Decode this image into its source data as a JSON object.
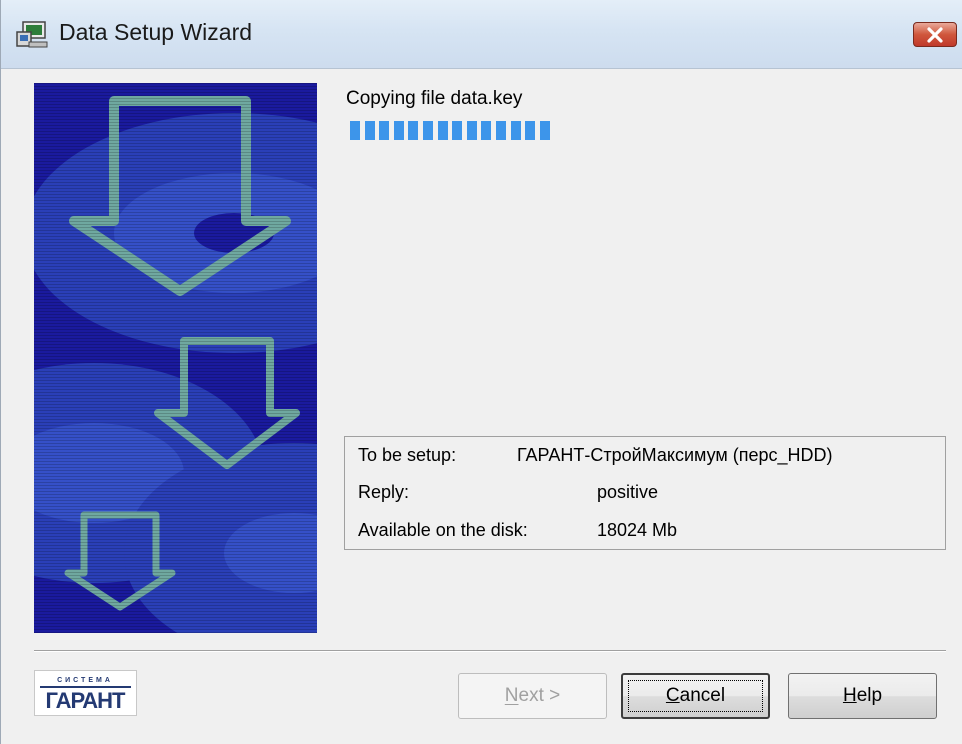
{
  "window": {
    "title": "Data Setup Wizard",
    "title_icon": "setup-wizard-icon",
    "close_icon": "close-icon"
  },
  "main": {
    "status_label": "Copying file data.key",
    "progress": {
      "filled_blocks": 14
    },
    "info": {
      "rows": [
        {
          "key": "To be setup:",
          "value": "ГАРАНТ-СтройМаксимум (перс_HDD)"
        },
        {
          "key": "Reply:",
          "value": "positive"
        },
        {
          "key": "Available on the disk:",
          "value": "18024 Mb"
        }
      ]
    }
  },
  "footer": {
    "logo_text": "ГАРАНТ",
    "logo_caption": "СИСТЕМА",
    "buttons": {
      "next": "Next >",
      "cancel": "Cancel",
      "help": "Help"
    }
  },
  "colors": {
    "progress_fill": "#3d95ea",
    "side_panel_blue": "#1a1a9e",
    "arrow_teal": "#6fa8a0"
  }
}
